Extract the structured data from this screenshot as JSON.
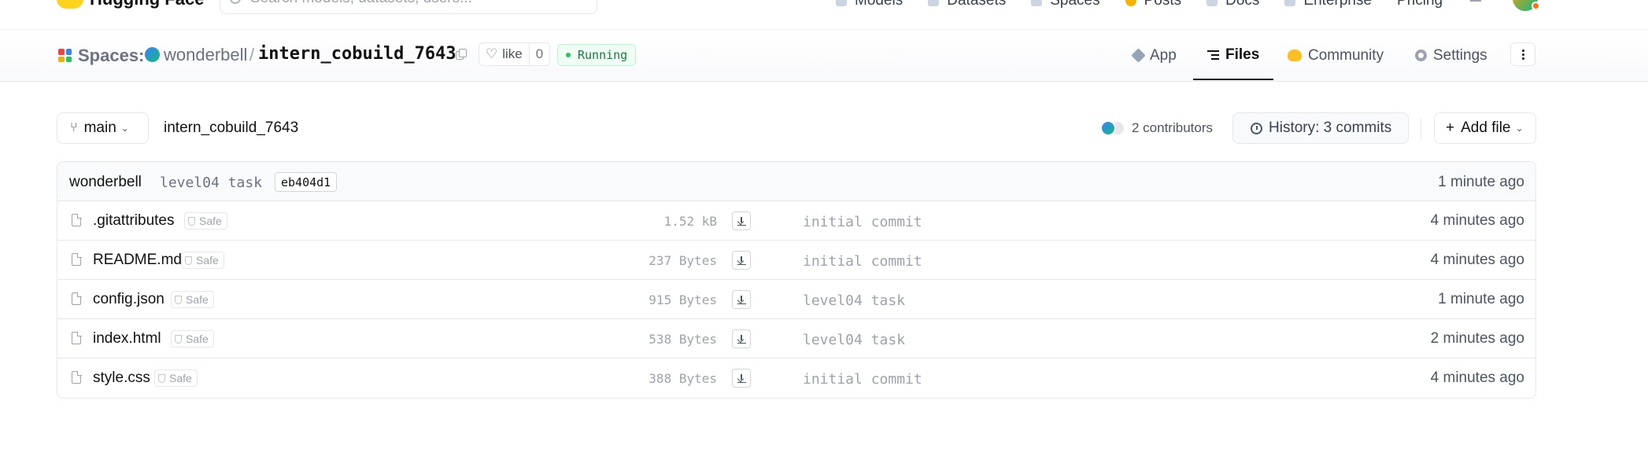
{
  "topnav": {
    "logo_text": "Hugging Face",
    "search_placeholder": "Search models, datasets, users...",
    "links": [
      "Models",
      "Datasets",
      "Spaces",
      "Posts",
      "Docs",
      "Enterprise",
      "Pricing"
    ]
  },
  "header": {
    "section": "Spaces:",
    "owner": "wonderbell",
    "separator": "/",
    "repo": "intern_cobuild_7643",
    "like_label": "like",
    "like_count": "0",
    "status": "Running",
    "tabs": [
      {
        "label": "App",
        "icon": "cube-icon"
      },
      {
        "label": "Files",
        "icon": "files-icon",
        "active": true
      },
      {
        "label": "Community",
        "icon": "community-icon"
      },
      {
        "label": "Settings",
        "icon": "gear-icon"
      }
    ]
  },
  "toolbar": {
    "branch": "main",
    "path": "intern_cobuild_7643",
    "contributors": "2 contributors",
    "history": "History: 3 commits",
    "add_file": "Add file"
  },
  "last_commit": {
    "author": "wonderbell",
    "message": "level04 task",
    "sha": "eb404d1",
    "time": "1 minute ago"
  },
  "files": [
    {
      "name": ".gitattributes",
      "badge": "Safe",
      "size": "1.52 kB",
      "commit": "initial commit",
      "time": "4 minutes ago"
    },
    {
      "name": "README.md",
      "badge": "Safe",
      "size": "237 Bytes",
      "commit": "initial commit",
      "time": "4 minutes ago"
    },
    {
      "name": "config.json",
      "badge": "Safe",
      "size": "915 Bytes",
      "commit": "level04 task",
      "time": "1 minute ago"
    },
    {
      "name": "index.html",
      "badge": "Safe",
      "size": "538 Bytes",
      "commit": "level04 task",
      "time": "2 minutes ago"
    },
    {
      "name": "style.css",
      "badge": "Safe",
      "size": "388 Bytes",
      "commit": "initial commit",
      "time": "4 minutes ago"
    }
  ],
  "colors": {
    "status_green": "#15803d",
    "brand_yellow": "#ffd21e"
  }
}
